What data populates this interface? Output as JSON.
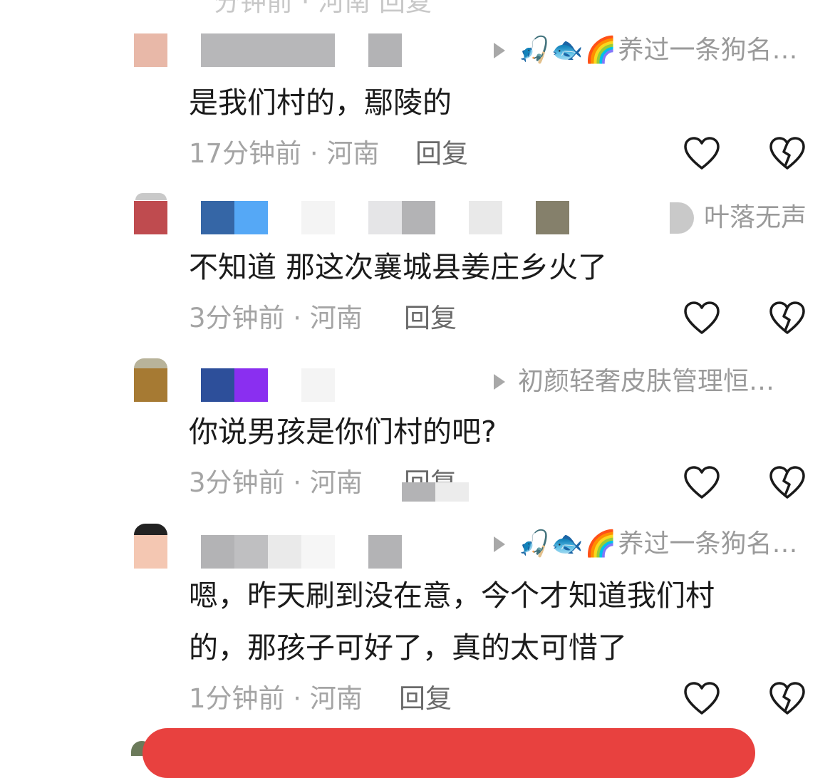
{
  "top_fragment": {
    "text": "分钟前 · 河南  回复"
  },
  "comments": [
    {
      "reply_to": "养过一条狗名…",
      "reply_emoji": [
        "🎣",
        "🐟",
        "🌈"
      ],
      "text": "是我们村的，鄢陵的",
      "time": "17分钟前 · 河南",
      "reply_label": "回复"
    },
    {
      "reply_to": "叶落无声",
      "reply_emoji": [],
      "text": "不知道 那这次襄城县姜庄乡火了",
      "time": "3分钟前 · 河南",
      "reply_label": "回复"
    },
    {
      "reply_to": "初颜轻奢皮肤管理恒…",
      "reply_emoji": [],
      "text": "你说男孩是你们村的吧?",
      "time": "3分钟前 · 河南",
      "reply_label": "回复"
    },
    {
      "reply_to": "养过一条狗名…",
      "reply_emoji": [
        "🎣",
        "🐟",
        "🌈"
      ],
      "text_lines": [
        "嗯，昨天刷到没在意，今个才知道我们村",
        "的，那孩子可好了，真的太可惜了"
      ],
      "time": "1分钟前 · 河南",
      "reply_label": "回复"
    }
  ],
  "icons": {
    "like": "heart-outline-icon",
    "dislike": "broken-heart-icon"
  },
  "colors": {
    "meta": "#a4a4a4",
    "reply_to": "#9a9a9a",
    "bottom_bar": "#e8413f"
  }
}
